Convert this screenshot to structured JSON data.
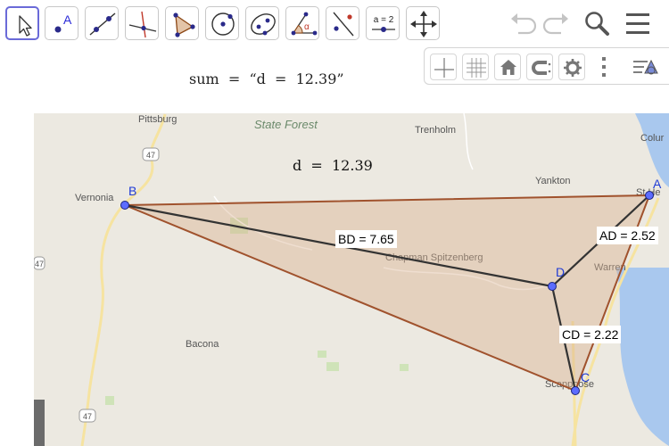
{
  "toolbar": {
    "tools": [
      {
        "name": "move-tool",
        "icon": "cursor-arrow-icon",
        "active": true
      },
      {
        "name": "point-tool",
        "icon": "point-icon",
        "active": false
      },
      {
        "name": "line-tool",
        "icon": "line-through-two-points-icon",
        "active": false
      },
      {
        "name": "perpendicular-line-tool",
        "icon": "perpendicular-line-icon",
        "active": false
      },
      {
        "name": "polygon-tool",
        "icon": "polygon-icon",
        "active": false
      },
      {
        "name": "circle-tool",
        "icon": "circle-with-center-icon",
        "active": false
      },
      {
        "name": "ellipse-tool",
        "icon": "ellipse-icon",
        "active": false
      },
      {
        "name": "angle-tool",
        "icon": "angle-icon",
        "active": false
      },
      {
        "name": "reflect-tool",
        "icon": "reflect-about-line-icon",
        "active": false
      },
      {
        "name": "slider-tool",
        "icon": "slider-icon",
        "label": "a = 2",
        "active": false
      },
      {
        "name": "move-graphics-view-tool",
        "icon": "move-arrows-icon",
        "active": false
      }
    ],
    "undo_icon": "undo-icon",
    "redo_icon": "redo-icon",
    "search_icon": "search-icon",
    "menu_icon": "hamburger-menu-icon"
  },
  "stylebar": {
    "buttons": [
      "axes-icon",
      "grid-icon",
      "home-icon",
      "magnet-snap-icon",
      "settings-gear-icon",
      "more-vertical-icon",
      "toggle-style-bar-icon"
    ]
  },
  "algebra": {
    "sum_text": "sum  =  “d  =  12.39”",
    "d_text": "d  =  12.39"
  },
  "map": {
    "place_labels": {
      "pittsburg": "Pittsburg",
      "state_forest": "State Forest",
      "trenholm": "Trenholm",
      "columbia": "Colur",
      "yankton": "Yankton",
      "vernonia": "Vernonia",
      "chapman": "Chapman Spitzenberg",
      "warren": "Warren",
      "bacona": "Bacona",
      "scappoose": "Scappoose",
      "st_helens": "St He",
      "route_47_top": "47",
      "route_47_bottom": "47",
      "route_47_left": "47"
    }
  },
  "geometry": {
    "points": {
      "A": "A",
      "B": "B",
      "C": "C",
      "D": "D"
    },
    "segment_labels": {
      "BD": "BD = 7.65",
      "AD": "AD = 2.52",
      "CD": "CD = 2.22"
    },
    "colors": {
      "triangle_fill": "#d9b08f",
      "triangle_edge": "#a0522d",
      "segment": "#333333",
      "point_fill": "#5c6cff",
      "point_label": "#1f3bd6",
      "active_tool_border": "#6a6ad8"
    }
  }
}
